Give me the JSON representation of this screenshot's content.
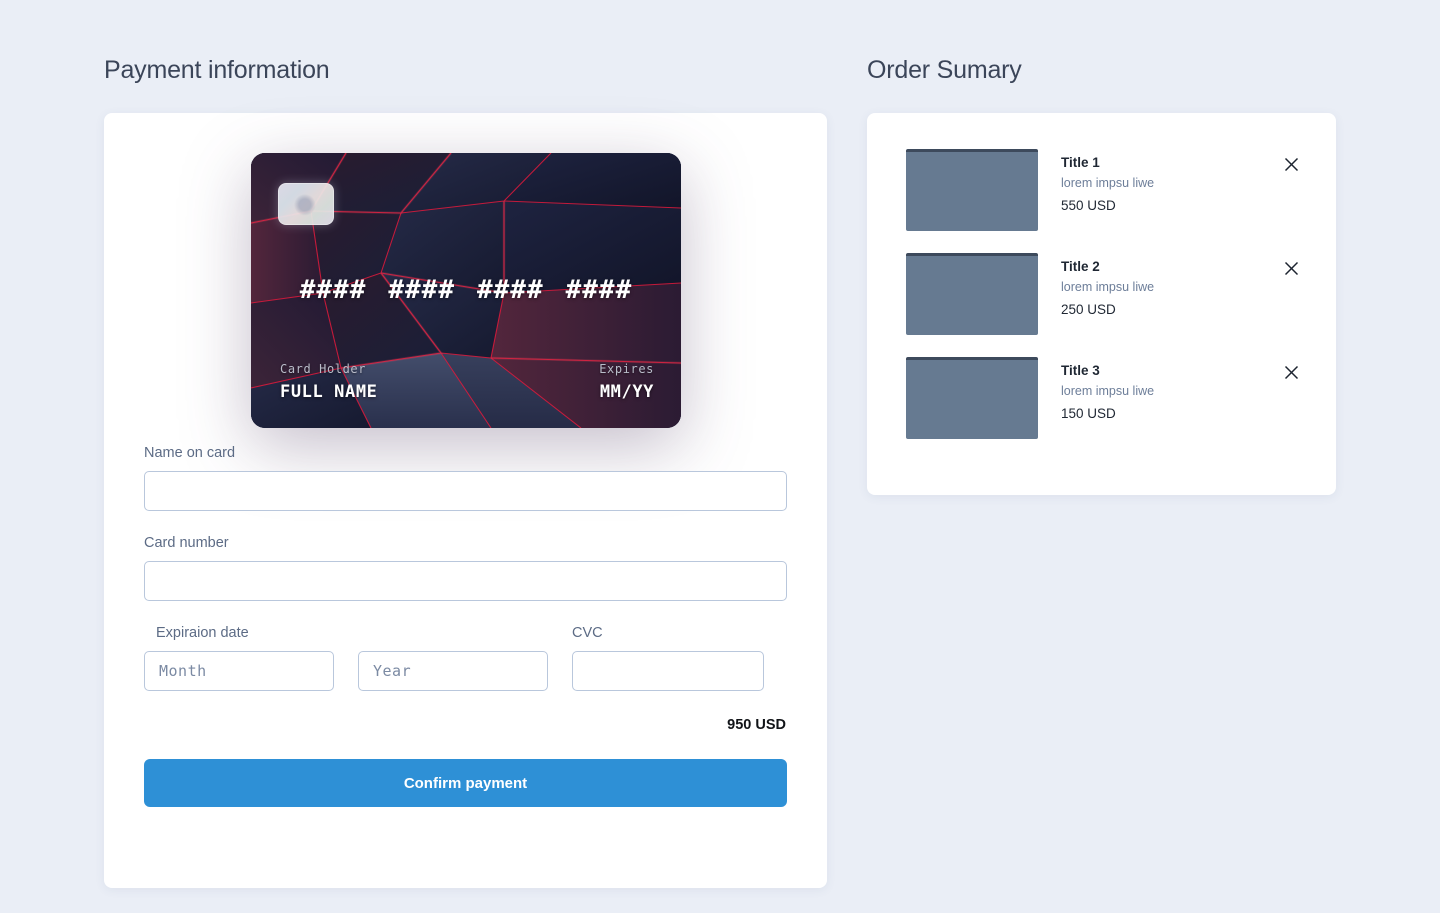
{
  "page": {
    "background_color": "#eaeef6"
  },
  "payment": {
    "heading": "Payment information",
    "card_preview": {
      "number_groups": [
        "####",
        "####",
        "####",
        "####"
      ],
      "holder_label": "Card Holder",
      "holder_value": "FULL NAME",
      "expires_label": "Expires",
      "expires_value": "MM/YY",
      "chip_icon": "card-chip-icon"
    },
    "fields": {
      "name_label": "Name on card",
      "name_value": "",
      "name_placeholder": "",
      "number_label": "Card number",
      "number_value": "",
      "number_placeholder": "",
      "expiration_label": "Expiraion date",
      "month_value": "",
      "month_placeholder": "Month",
      "year_value": "",
      "year_placeholder": "Year",
      "cvc_label": "CVC",
      "cvc_value": "",
      "cvc_placeholder": ""
    },
    "total": "950 USD",
    "confirm_label": "Confirm payment",
    "accent_color": "#2e90d6"
  },
  "summary": {
    "heading": "Order Sumary",
    "remove_icon": "close-icon",
    "items": [
      {
        "title": "Title 1",
        "description": "lorem impsu liwe",
        "price": "550 USD",
        "thumb_color": "#667a91"
      },
      {
        "title": "Title 2",
        "description": "lorem impsu liwe",
        "price": "250 USD",
        "thumb_color": "#667a91"
      },
      {
        "title": "Title 3",
        "description": "lorem impsu liwe",
        "price": "150 USD",
        "thumb_color": "#667a91"
      }
    ]
  }
}
